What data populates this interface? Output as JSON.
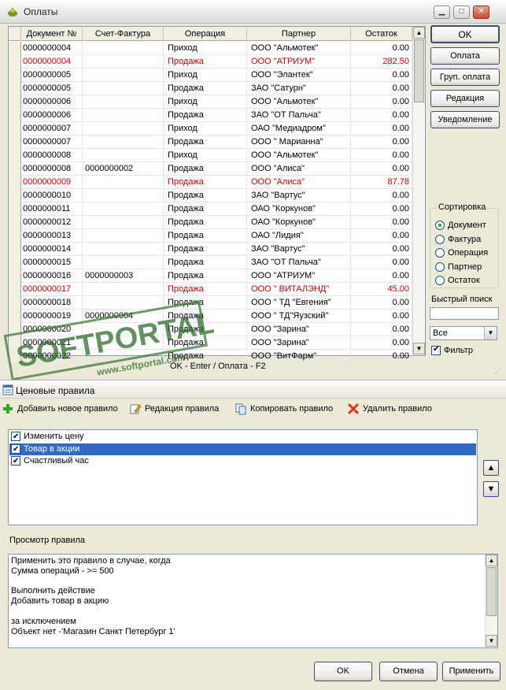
{
  "payments": {
    "title": "Оплаты",
    "columns": [
      "Документ №",
      "Счет-Фактура",
      "Операция",
      "Партнер",
      "Остаток"
    ],
    "rows": [
      {
        "doc": "0000000004",
        "invoice": "",
        "op": "Приход",
        "partner": "ООО \"Альмотек\"",
        "rest": "0.00",
        "red": false
      },
      {
        "doc": "0000000004",
        "invoice": "",
        "op": "Продажа",
        "partner": "ООО \"АТРИУМ\"",
        "rest": "282.50",
        "red": true
      },
      {
        "doc": "0000000005",
        "invoice": "",
        "op": "Приход",
        "partner": "ООО \"Элантек\"",
        "rest": "0.00",
        "red": false
      },
      {
        "doc": "0000000005",
        "invoice": "",
        "op": "Продажа",
        "partner": "ЗАО \"Сатурн\"",
        "rest": "0.00",
        "red": false
      },
      {
        "doc": "0000000006",
        "invoice": "",
        "op": "Приход",
        "partner": "ООО \"Альмотек\"",
        "rest": "0.00",
        "red": false
      },
      {
        "doc": "0000000006",
        "invoice": "",
        "op": "Продажа",
        "partner": "ЗАО \"ОТ Пальча\"",
        "rest": "0.00",
        "red": false
      },
      {
        "doc": "0000000007",
        "invoice": "",
        "op": "Приход",
        "partner": "ОАО \"Медиадром\"",
        "rest": "0.00",
        "red": false
      },
      {
        "doc": "0000000007",
        "invoice": "",
        "op": "Продажа",
        "partner": "ООО \" Марианна\"",
        "rest": "0.00",
        "red": false
      },
      {
        "doc": "0000000008",
        "invoice": "",
        "op": "Приход",
        "partner": "ООО \"Альмотек\"",
        "rest": "0.00",
        "red": false
      },
      {
        "doc": "0000000008",
        "invoice": "0000000002",
        "op": "Продажа",
        "partner": "ООО \"Алиса\"",
        "rest": "0.00",
        "red": false
      },
      {
        "doc": "0000000009",
        "invoice": "",
        "op": "Продажа",
        "partner": "ООО \"Алиса\"",
        "rest": "87.78",
        "red": true
      },
      {
        "doc": "0000000010",
        "invoice": "",
        "op": "Продажа",
        "partner": "ЗАО \"Вартус\"",
        "rest": "0.00",
        "red": false
      },
      {
        "doc": "0000000011",
        "invoice": "",
        "op": "Продажа",
        "partner": "ОАО \"Коркунов\"",
        "rest": "0.00",
        "red": false
      },
      {
        "doc": "0000000012",
        "invoice": "",
        "op": "Продажа",
        "partner": "ОАО \"Коркунов\"",
        "rest": "0.00",
        "red": false
      },
      {
        "doc": "0000000013",
        "invoice": "",
        "op": "Продажа",
        "partner": "ОАО \"Лидия\"",
        "rest": "0.00",
        "red": false
      },
      {
        "doc": "0000000014",
        "invoice": "",
        "op": "Продажа",
        "partner": "ЗАО \"Вартус\"",
        "rest": "0.00",
        "red": false
      },
      {
        "doc": "0000000015",
        "invoice": "",
        "op": "Продажа",
        "partner": "ЗАО \"ОТ Пальча\"",
        "rest": "0.00",
        "red": false
      },
      {
        "doc": "0000000016",
        "invoice": "0000000003",
        "op": "Продажа",
        "partner": "ООО \"АТРИУМ\"",
        "rest": "0.00",
        "red": false
      },
      {
        "doc": "0000000017",
        "invoice": "",
        "op": "Продажа",
        "partner": "ООО \" ВИТАЛЭНД\"",
        "rest": "45.00",
        "red": true
      },
      {
        "doc": "0000000018",
        "invoice": "",
        "op": "Продажа",
        "partner": "ООО \" ТД \"Евгения\"",
        "rest": "0.00",
        "red": false
      },
      {
        "doc": "0000000019",
        "invoice": "0000000004",
        "op": "Продажа",
        "partner": "ООО \" ТД\"Яузский\"",
        "rest": "0.00",
        "red": false
      },
      {
        "doc": "0000000020",
        "invoice": "",
        "op": "Продажа",
        "partner": "ООО \"Зарина\"",
        "rest": "0.00",
        "red": false
      },
      {
        "doc": "0000000021",
        "invoice": "",
        "op": "Продажа",
        "partner": "ООО \"Зарина\"",
        "rest": "0.00",
        "red": false
      },
      {
        "doc": "0000000022",
        "invoice": "",
        "op": "Продажа",
        "partner": "ООО \"ВитФарм\"",
        "rest": "0.00",
        "red": false
      }
    ],
    "buttons": {
      "ok": "OK",
      "pay": "Оплата",
      "group_pay": "Груп. оплата",
      "edit": "Редакция",
      "notify": "Уведомление"
    },
    "sort": {
      "legend": "Сортировка",
      "options": [
        "Документ",
        "Фактура",
        "Операция",
        "Партнер",
        "Остаток"
      ],
      "selected": 0
    },
    "quick_search_label": "Быстрый поиск",
    "quick_search_value": "",
    "filter_select": "Все",
    "filter_label": "Фильтр",
    "filter_checked": true,
    "status": "OK - Enter / Оплата - F2",
    "watermark_brand": "SOFTPORTAL",
    "watermark_url": "www.softportal.com"
  },
  "rules": {
    "title": "Ценовые правила",
    "toolbar": {
      "add": "Добавить новое правило",
      "edit": "Редакция  правила",
      "copy": "Копировать правило",
      "delete": "Удалить правило"
    },
    "items": [
      {
        "label": "Изменить цену",
        "checked": true,
        "selected": false
      },
      {
        "label": "Товар в акции",
        "checked": true,
        "selected": true
      },
      {
        "label": "Счастливый час",
        "checked": true,
        "selected": false
      }
    ],
    "view_label": "Просмотр правила",
    "view_lines": [
      "Применить это правило в случае, когда",
      "Сумма операций  -  >= 500",
      "",
      "Выполнить действие",
      "Добавить товар в акцию",
      "",
      "за исключением",
      "Объект нет -'Магазин Санкт Петербург 1'"
    ],
    "buttons": {
      "ok": "OK",
      "cancel": "Отмена",
      "apply": "Применить"
    },
    "up_arrow": "▲",
    "down_arrow": "▼"
  }
}
